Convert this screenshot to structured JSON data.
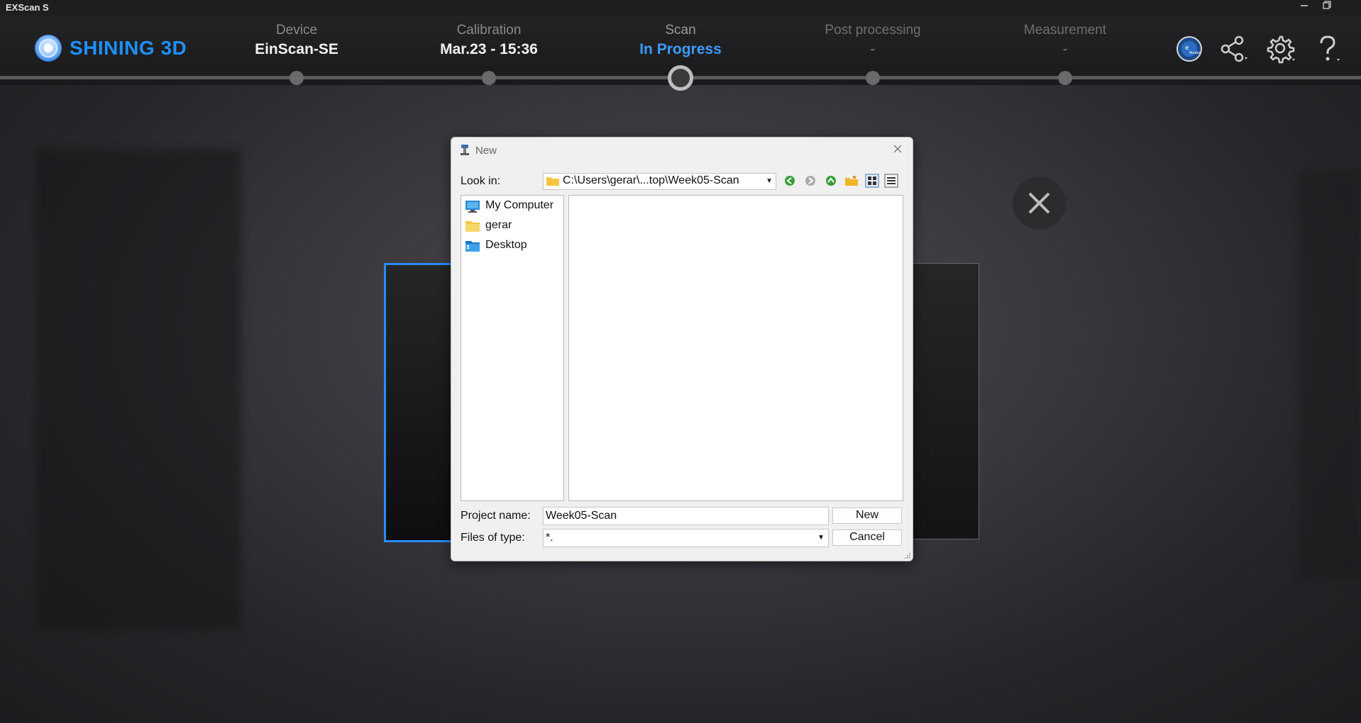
{
  "window": {
    "title": "EXScan S",
    "controls": [
      "minimize-icon",
      "restore-icon"
    ]
  },
  "brand": {
    "name": "SHINING 3D",
    "color": "#1e90ff"
  },
  "steps": [
    {
      "label": "Device",
      "value": "EinScan-SE",
      "state": "done"
    },
    {
      "label": "Calibration",
      "value": "Mar.23 - 15:36",
      "state": "done"
    },
    {
      "label": "Scan",
      "value": "In Progress",
      "state": "active"
    },
    {
      "label": "Post processing",
      "value": "-",
      "state": "pending"
    },
    {
      "label": "Measurement",
      "value": "-",
      "state": "pending"
    }
  ],
  "header_icons": [
    "model-globe-icon",
    "share-icon",
    "settings-gear-icon",
    "help-icon"
  ],
  "accent_color": "#3d9bff",
  "dialog": {
    "title": "New",
    "look_in_label": "Look in:",
    "look_in_path": "C:\\Users\\gerar\\...top\\Week05-Scan",
    "toolbar_icons": [
      "back-icon",
      "forward-icon",
      "up-folder-icon",
      "new-folder-icon",
      "list-view-icon",
      "detail-view-icon"
    ],
    "places": [
      {
        "label": "My Computer",
        "icon": "computer-icon"
      },
      {
        "label": "gerar",
        "icon": "folder-icon"
      },
      {
        "label": "Desktop",
        "icon": "desktop-icon"
      }
    ],
    "project_name_label": "Project name:",
    "project_name_value": "Week05-Scan",
    "files_of_type_label": "Files of type:",
    "files_of_type_value": "*.",
    "new_button": "New",
    "cancel_button": "Cancel"
  }
}
